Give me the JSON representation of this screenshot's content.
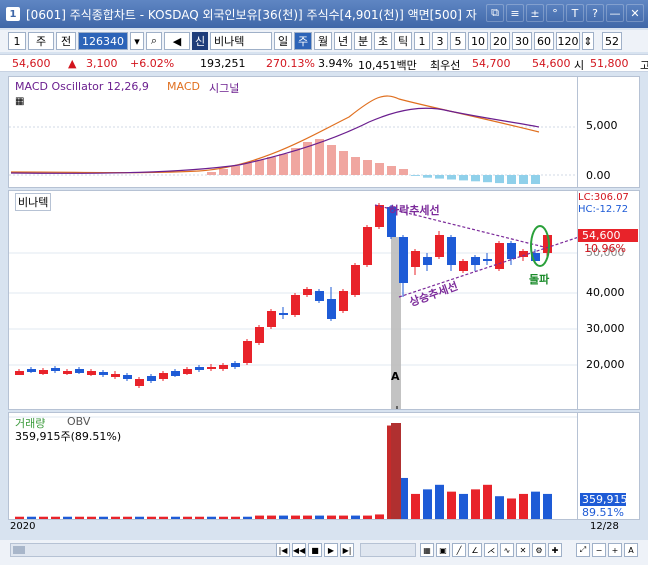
{
  "window": {
    "number": "1",
    "title": "[0601] 주식종합차트 - KOSDAQ 외국인보유[36(천)] 주식수[4,901(천)] 액면[500] 자"
  },
  "title_icons": [
    "⧉",
    "≡",
    "±",
    "°",
    "T",
    "?",
    "—",
    "✕"
  ],
  "toolbar": {
    "num": "1",
    "market": "주",
    "scope": "전",
    "code": "126340",
    "stock_tag": "신",
    "stock_name": "비나텍",
    "periods": [
      "일",
      "주",
      "월",
      "년",
      "분",
      "초",
      "틱"
    ],
    "active_period": "주",
    "intervals": [
      "1",
      "3",
      "5",
      "10",
      "20",
      "30",
      "60",
      "120"
    ],
    "count": "52"
  },
  "quote": {
    "price": "54,600",
    "change": "3,100",
    "rate": "+6.02%",
    "volume": "193,251",
    "vol_ratio": "270.13%",
    "turnover": "3.94%",
    "amount": "10,451백만",
    "best_ask_label": "최우선",
    "ask": "54,700",
    "bid": "54,600",
    "open_label": "시",
    "open": "51,800",
    "high_label": "고"
  },
  "macd": {
    "title": "MACD Oscillator 12,26,9",
    "macd_label": "MACD",
    "signal_label": "시그널",
    "ticks": [
      "5,000",
      "0.00"
    ]
  },
  "price_panel": {
    "stock_label": "비나텍",
    "lc": "LC:306.07",
    "hc": "HC:-12.72",
    "current": "54,600",
    "rate": "10.96%",
    "tick_top": "50,000",
    "ticks": [
      "40,000",
      "30,000",
      "20,000"
    ],
    "downtrend": "하락추세선",
    "uptrend": "상승추세선",
    "breakout": "돌파",
    "marker": "A"
  },
  "volume_panel": {
    "title": "거래량",
    "obv": "OBV",
    "value": "359,915주(89.51%)",
    "axis_value": "359,915",
    "axis_pct": "89.51%"
  },
  "footer": {
    "year": "2020",
    "date": "12/28"
  },
  "colors": {
    "up": "#e8232a",
    "down": "#1e5bd6",
    "macd": "#6b1f8f",
    "signal": "#e07020",
    "osc_up": "#f0a6a0",
    "osc_down": "#8fd0ea"
  }
}
